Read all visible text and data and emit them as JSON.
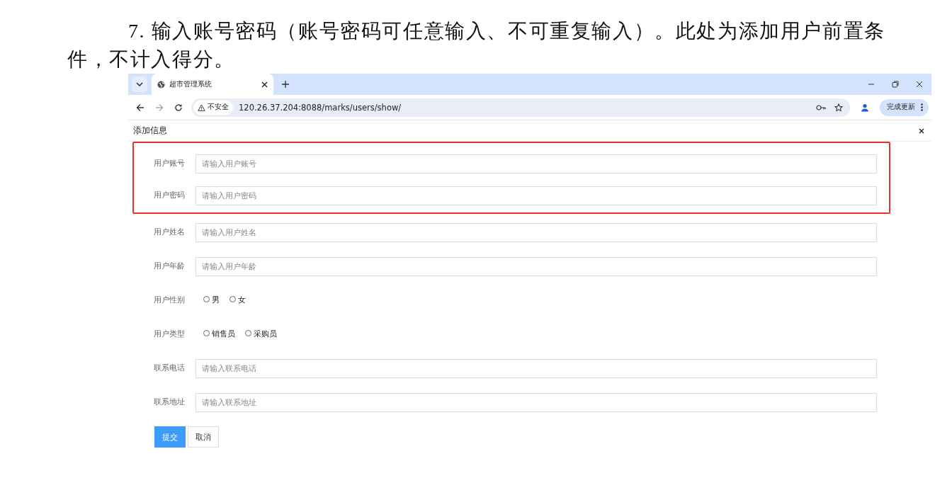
{
  "document": {
    "paragraph": "7. 输入账号密码（账号密码可任意输入、不可重复输入）。此处为添加用户前置条件，不计入得分。"
  },
  "browser": {
    "tab": {
      "title": "超市管理系统",
      "selected": true
    },
    "security_label": "不安全",
    "url": "120.26.37.204:8088/marks/users/show/",
    "update_button": "完成更新"
  },
  "dialog": {
    "title": "添加信息",
    "fields": [
      {
        "kind": "input",
        "label": "用户账号",
        "placeholder": "请输入用户账号",
        "highlighted": true
      },
      {
        "kind": "input",
        "label": "用户密码",
        "placeholder": "请输入用户密码",
        "highlighted": true
      },
      {
        "kind": "input",
        "label": "用户姓名",
        "placeholder": "请输入用户姓名",
        "highlighted": false
      },
      {
        "kind": "input",
        "label": "用户年龄",
        "placeholder": "请输入用户年龄",
        "highlighted": false
      },
      {
        "kind": "radio",
        "label": "用户性别",
        "options": [
          {
            "label": "男",
            "selected": false
          },
          {
            "label": "女",
            "selected": false
          }
        ],
        "highlighted": false
      },
      {
        "kind": "radio",
        "label": "用户类型",
        "options": [
          {
            "label": "销售员",
            "selected": false
          },
          {
            "label": "采购员",
            "selected": false
          }
        ],
        "highlighted": false
      },
      {
        "kind": "input",
        "label": "联系电话",
        "placeholder": "请输入联系电话",
        "highlighted": false
      },
      {
        "kind": "input",
        "label": "联系地址",
        "placeholder": "请输入联系地址",
        "highlighted": false
      }
    ],
    "buttons": [
      {
        "label": "提交",
        "kind": "primary"
      },
      {
        "label": "取消",
        "kind": "default"
      }
    ]
  }
}
